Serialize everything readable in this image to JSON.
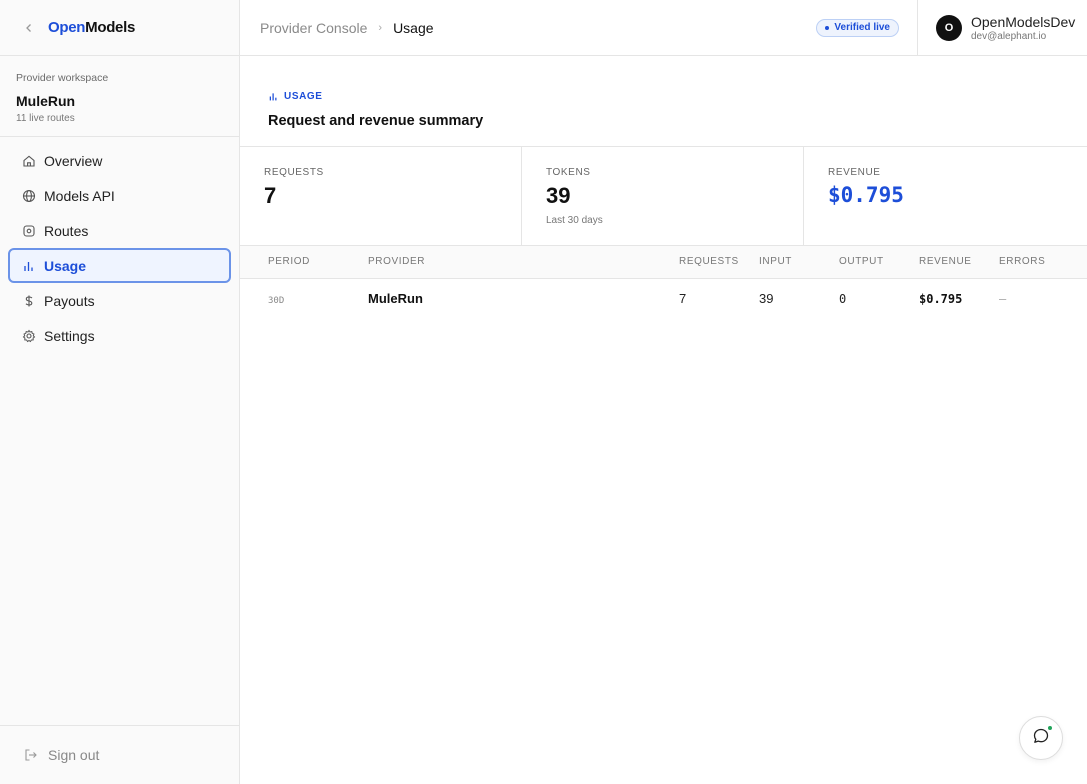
{
  "brand": {
    "logo_part1": "Open",
    "logo_part2": "Models"
  },
  "workspace": {
    "label": "Provider workspace",
    "name": "MuleRun",
    "subtitle": "11 live routes"
  },
  "nav": [
    {
      "label": "Overview",
      "icon": "home-icon"
    },
    {
      "label": "Models API",
      "icon": "globe-icon"
    },
    {
      "label": "Routes",
      "icon": "routes-icon"
    },
    {
      "label": "Usage",
      "icon": "bar-chart-icon",
      "active": true
    },
    {
      "label": "Payouts",
      "icon": "dollar-icon"
    },
    {
      "label": "Settings",
      "icon": "gear-icon"
    }
  ],
  "signout": {
    "label": "Sign out"
  },
  "header": {
    "breadcrumb": [
      "Provider Console",
      "Usage"
    ],
    "badge": "Verified live",
    "user": {
      "initial": "O",
      "name": "OpenModelsDev",
      "email": "dev@alephant.io"
    }
  },
  "section": {
    "tag": "USAGE",
    "title": "Request and revenue summary"
  },
  "stats": [
    {
      "label": "REQUESTS",
      "value": "7",
      "note": ""
    },
    {
      "label": "TOKENS",
      "value": "39",
      "note": "Last 30 days"
    },
    {
      "label": "REVENUE",
      "value": "$0.795",
      "note": ""
    }
  ],
  "table": {
    "columns": [
      "PERIOD",
      "PROVIDER",
      "REQUESTS",
      "INPUT",
      "OUTPUT",
      "REVENUE",
      "ERRORS"
    ],
    "rows": [
      {
        "period": "30D",
        "provider": "MuleRun",
        "requests": "7",
        "input": "39",
        "output": "0",
        "revenue": "$0.795",
        "errors": "–"
      }
    ]
  },
  "colors": {
    "accent": "#1d4ed8",
    "active_border": "#6b93e8",
    "online": "#22a35a"
  }
}
